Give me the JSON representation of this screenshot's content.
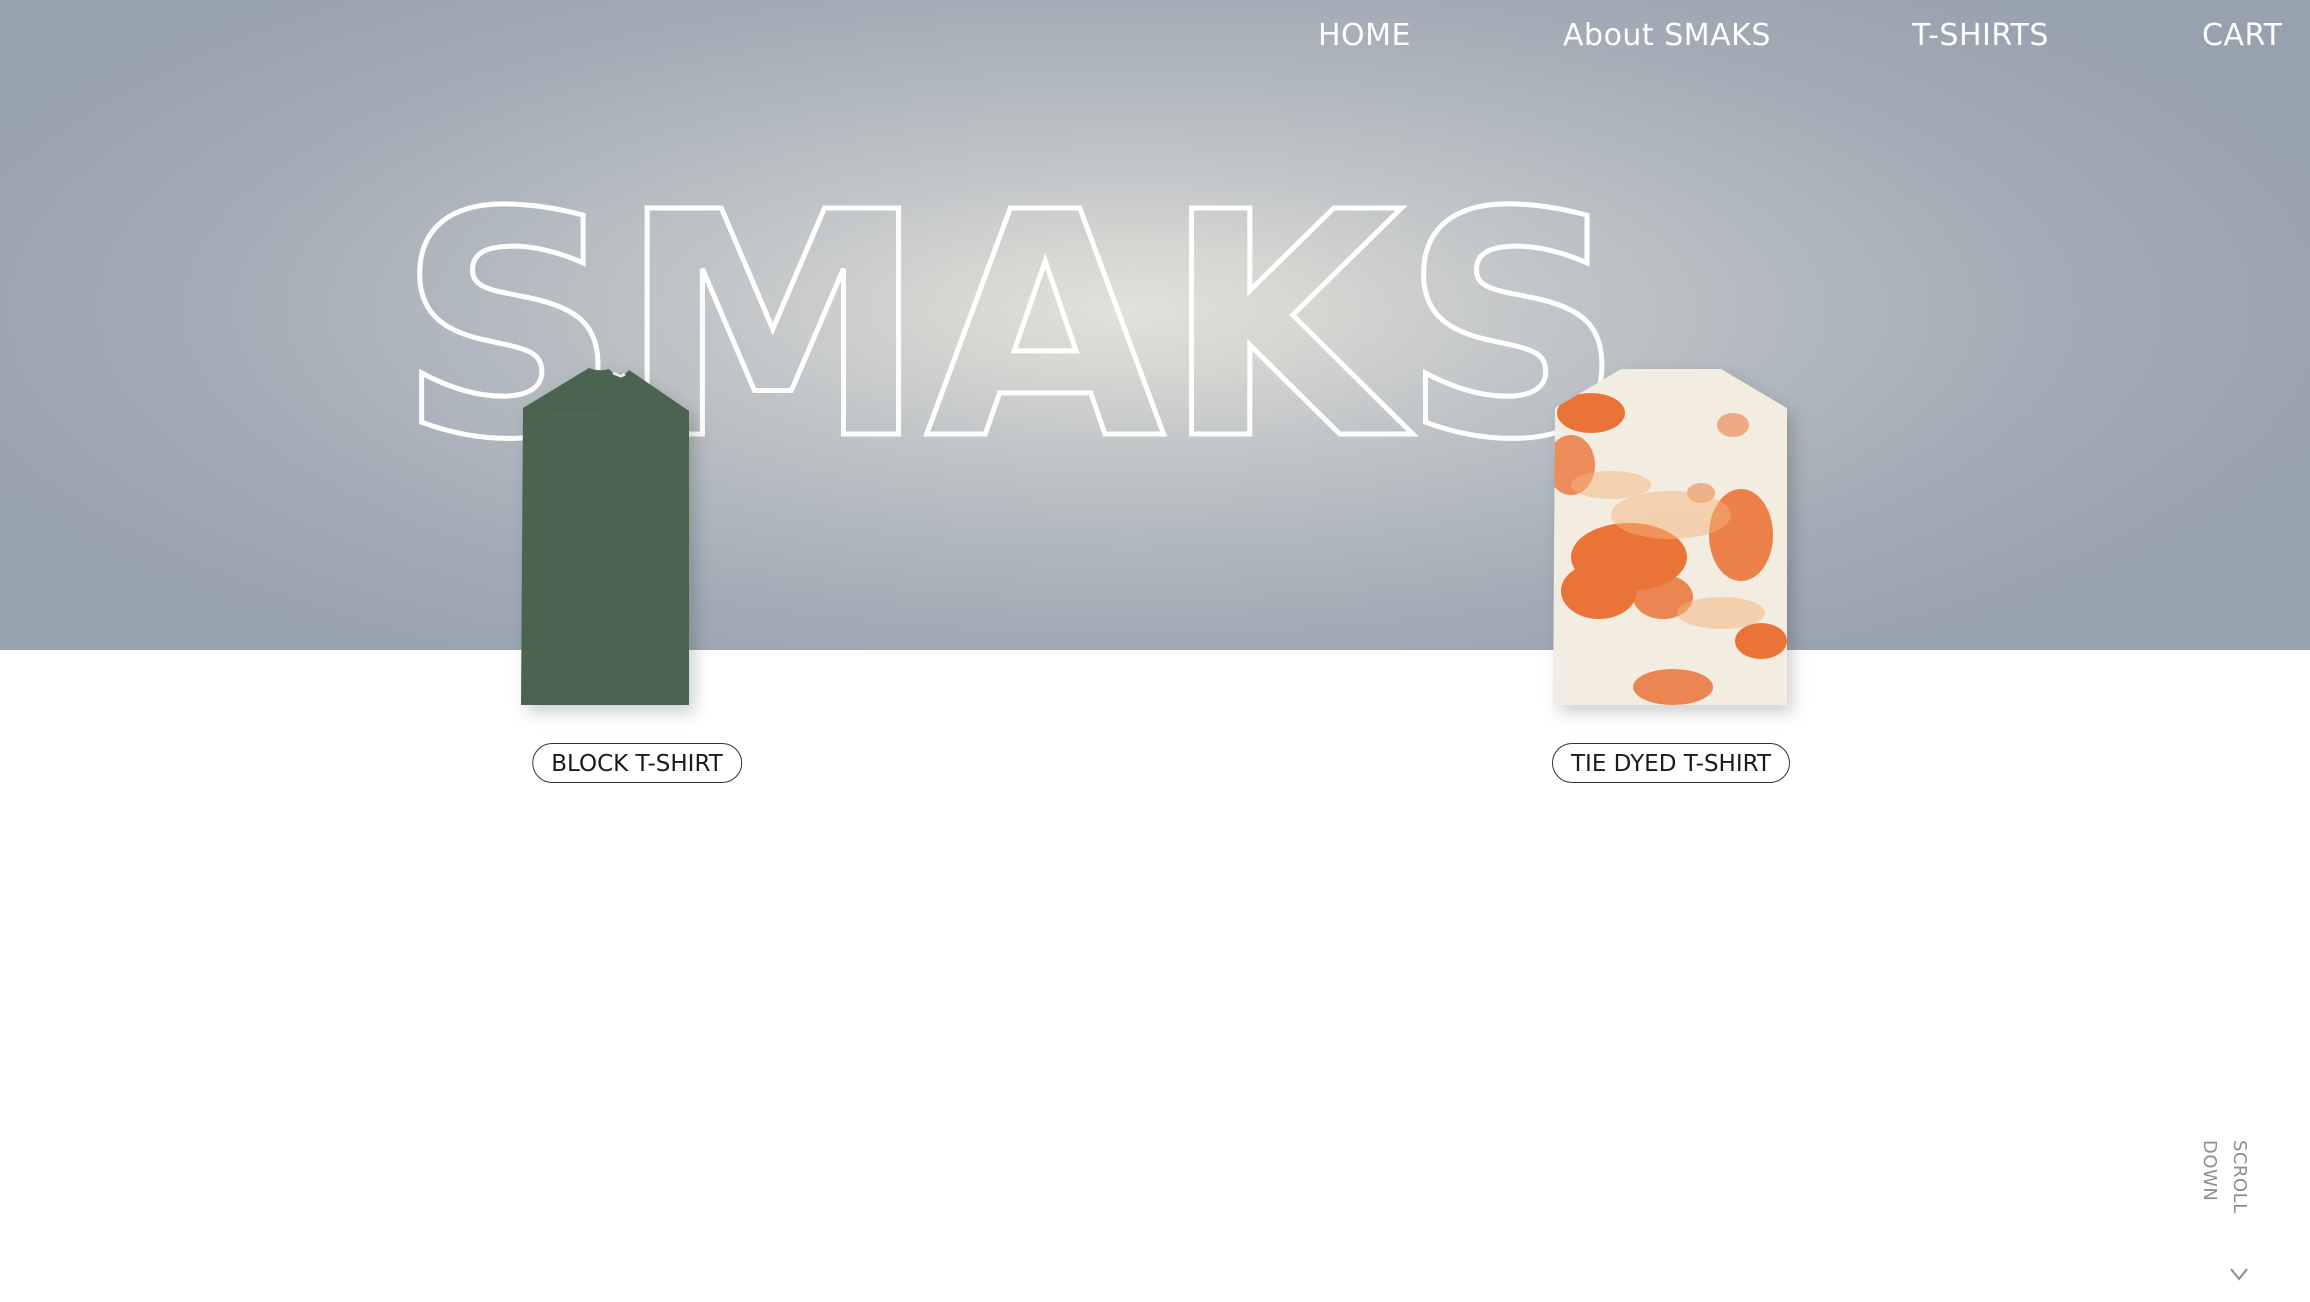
{
  "nav": {
    "items": [
      {
        "label": "HOME"
      },
      {
        "label": "About SMAKS"
      },
      {
        "label": "T-SHIRTS"
      },
      {
        "label": "CART"
      }
    ]
  },
  "hero": {
    "brand": "SMAKS"
  },
  "products": [
    {
      "label": "BLOCK T-SHIRT",
      "color": "#4a6450"
    },
    {
      "label": "TIE DYED T-SHIRT",
      "color": "#f2ece1",
      "accent": "#ea6a2a"
    }
  ],
  "scroll": {
    "label": "SCROLL DOWN",
    "icon": "chevron-down-icon"
  },
  "colors": {
    "nav_text": "#ffffff",
    "hero_edge": "#97a2af",
    "hero_center": "#e2e1da"
  }
}
